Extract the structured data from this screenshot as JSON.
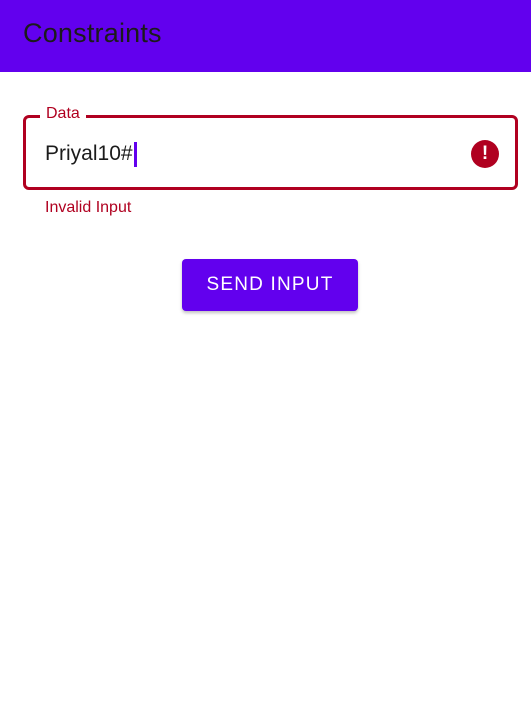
{
  "app_bar": {
    "title": "Constraints"
  },
  "form": {
    "field": {
      "label": "Data",
      "value": "Priyal10#",
      "error_text": "Invalid Input",
      "error_icon": "error-icon",
      "error_glyph": "!"
    },
    "submit_label": "SEND INPUT"
  },
  "colors": {
    "primary": "#6200ee",
    "error": "#b00020",
    "background": "#ffffff",
    "text": "#1b1b1b"
  }
}
